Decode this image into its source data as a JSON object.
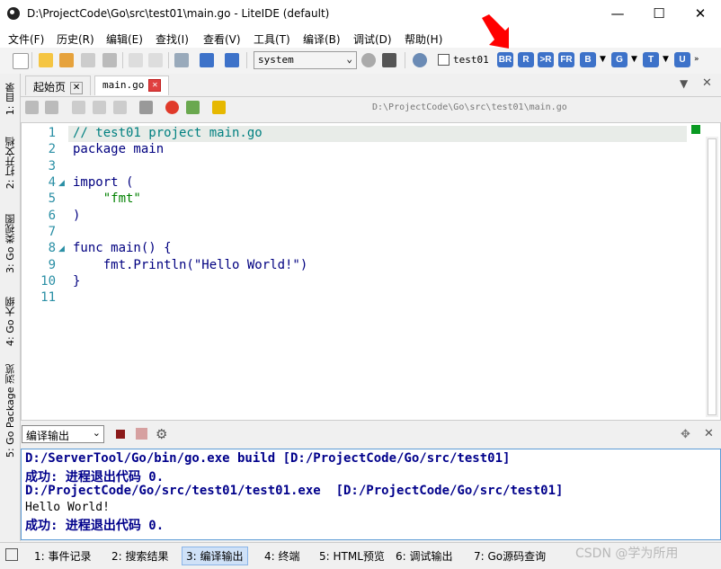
{
  "window": {
    "title": "D:\\ProjectCode\\Go\\src\\test01\\main.go - LiteIDE (default)",
    "minimize": "—",
    "maximize": "☐",
    "close": "✕"
  },
  "menu": [
    "文件(F)",
    "历史(R)",
    "编辑(E)",
    "查找(I)",
    "查看(V)",
    "工具(T)",
    "编译(B)",
    "调试(D)",
    "帮助(H)"
  ],
  "toolbar": {
    "build_env": "system",
    "target_label": "test01",
    "build_buttons": [
      "BR",
      "R",
      ">R",
      "FR",
      "B",
      "G",
      "T",
      "U"
    ]
  },
  "side_tabs": [
    "1: 目录",
    "2: 打开文档",
    "3: Go 类视图",
    "4: Go 大纲",
    "5: Go Package 浏览"
  ],
  "tabs": [
    {
      "label": "起始页",
      "close": "✕"
    },
    {
      "label": "main.go",
      "close": "✕"
    }
  ],
  "editor": {
    "file_path": "D:\\ProjectCode\\Go\\src\\test01\\main.go",
    "line_numbers": [
      "1",
      "2",
      "3",
      "4",
      "5",
      "6",
      "7",
      "8",
      "9",
      "10",
      "11"
    ],
    "lines": [
      "// test01 project main.go",
      "package main",
      "",
      "import (",
      "    \"fmt\"",
      ")",
      "",
      "func main() {",
      "    fmt.Println(\"Hello World!\")",
      "}",
      ""
    ],
    "fold_marks": [
      "◢",
      "◢"
    ]
  },
  "output": {
    "selector": "编译输出",
    "lines": [
      "D:/ServerTool/Go/bin/go.exe build [D:/ProjectCode/Go/src/test01]",
      "成功: 进程退出代码 0.",
      "D:/ProjectCode/Go/src/test01/test01.exe  [D:/ProjectCode/Go/src/test01]",
      "Hello World!",
      "成功: 进程退出代码 0."
    ]
  },
  "bottom_tabs": [
    "1: 事件记录",
    "2: 搜索结果",
    "3: 编译输出",
    "4: 终端",
    "5: HTML预览",
    "6: 调试输出",
    "7: Go源码查询"
  ],
  "watermark": "CSDN @学为所用",
  "colors": {
    "accent": "#3d72c9",
    "line_number": "#2a8fa5",
    "string": "#008000",
    "keyword": "#000080"
  }
}
